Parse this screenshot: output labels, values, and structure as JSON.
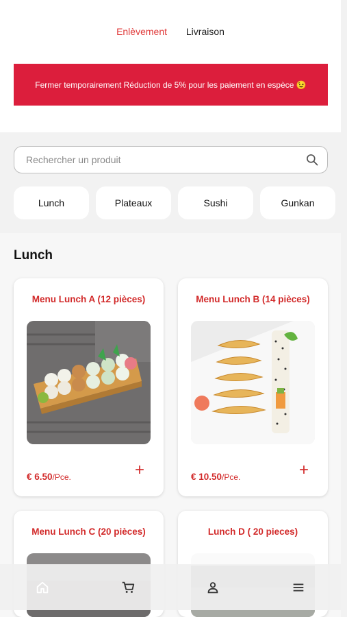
{
  "delivery_modes": {
    "pickup": "Enlèvement",
    "delivery": "Livraison"
  },
  "banner": {
    "text": "Fermer temporairement Réduction de 5% pour les paiement en espèce 😉"
  },
  "search": {
    "placeholder": "Rechercher un produit"
  },
  "categories": [
    "Lunch",
    "Plateaux",
    "Sushi",
    "Gunkan"
  ],
  "section": {
    "title": "Lunch"
  },
  "products": [
    {
      "name": "Menu Lunch A (12 pièces)",
      "price": "€ 6.50",
      "unit": "/Pce.",
      "add": "+"
    },
    {
      "name": "Menu Lunch B (14 pièces)",
      "price": "€ 10.50",
      "unit": "/Pce.",
      "add": "+"
    },
    {
      "name": "Menu Lunch C (20 pièces)"
    },
    {
      "name": "Lunch D ( 20 pieces)"
    }
  ],
  "bottom_nav": [
    "home-icon",
    "cart-icon",
    "account-icon",
    "menu-icon"
  ],
  "colors": {
    "accent": "#d22a2a",
    "banner": "#dc1e3c"
  }
}
